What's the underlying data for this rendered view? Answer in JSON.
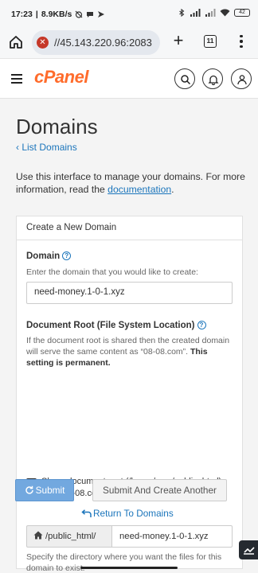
{
  "status_bar": {
    "time": "17:23",
    "network_speed": "8.9KB/s",
    "battery": "42"
  },
  "browser": {
    "url": "//45.143.220.96:2083",
    "tab_count": "11"
  },
  "header": {
    "logo": "cPanel"
  },
  "page": {
    "title": "Domains",
    "back_link": "List Domains",
    "intro_text": "Use this interface to manage your domains. For more information, read the ",
    "intro_link": "documentation",
    "intro_end": "."
  },
  "form": {
    "panel_title": "Create a New Domain",
    "domain": {
      "label": "Domain",
      "hint": "Enter the domain that you would like to create:",
      "value": "need-money.1-0-1.xyz"
    },
    "docroot": {
      "label": "Document Root (File System Location)",
      "hint": "If the document root is shared then the created domain will serve the same content as “08-08.com”.",
      "hint_bold": "This setting is permanent.",
      "share_label": "Share document root (/home/com/public_html) with “08-08.com”.",
      "share_checked": false,
      "prefix": "/public_html/",
      "value": "need-money.1-0-1.xyz",
      "dir_hint": "Specify the directory where you want the files for this domain to exist."
    },
    "submit_label": "Submit",
    "submit_another_label": "Submit And Create Another",
    "return_label": "Return To Domains"
  },
  "colors": {
    "accent": "#1b75bb",
    "brand": "#ff6c2c",
    "submit_bg": "#72a8df"
  }
}
